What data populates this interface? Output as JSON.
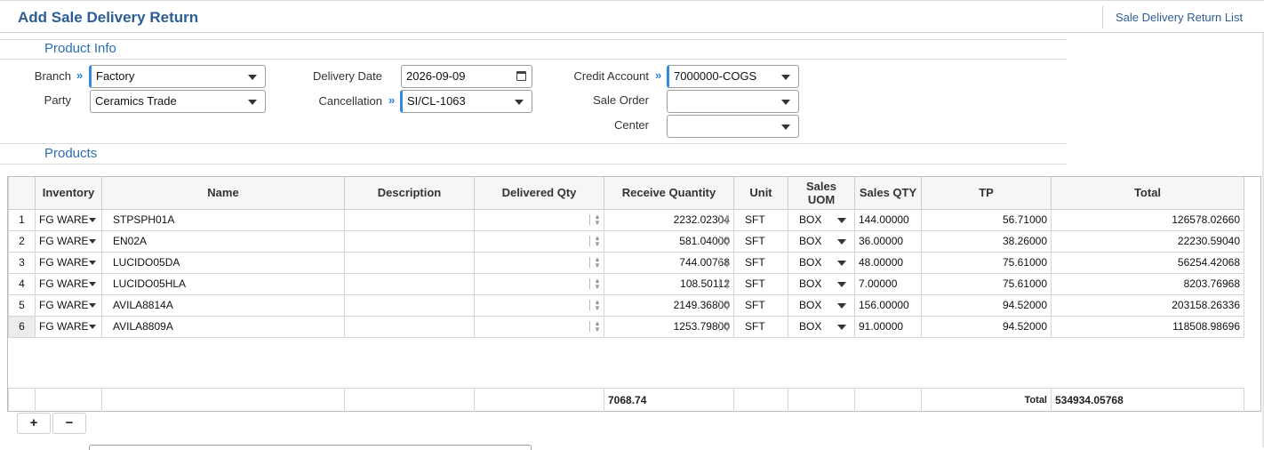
{
  "header": {
    "title": "Add Sale Delivery Return",
    "list_link": "Sale Delivery Return List"
  },
  "product_info": {
    "section_title": "Product Info",
    "branch": {
      "label": "Branch",
      "value": "Factory"
    },
    "party": {
      "label": "Party",
      "value": "Ceramics Trade"
    },
    "delivery_date": {
      "label": "Delivery Date",
      "value": "2026-09-09"
    },
    "cancellation": {
      "label": "Cancellation",
      "value": "SI/CL-1063"
    },
    "credit_account": {
      "label": "Credit Account",
      "value": "7000000-COGS"
    },
    "sale_order": {
      "label": "Sale Order",
      "value": ""
    },
    "center": {
      "label": "Center",
      "value": ""
    }
  },
  "products": {
    "section_title": "Products",
    "columns": [
      "Inventory",
      "Name",
      "Description",
      "Delivered Qty",
      "Receive Quantity",
      "Unit",
      "Sales UOM",
      "Sales QTY",
      "TP",
      "Total"
    ],
    "rows": [
      {
        "no": "1",
        "inventory": "FG WARE",
        "name": "STPSPH01A",
        "description": "",
        "delivered_qty": "",
        "receive_qty": "2232.02304",
        "unit": "SFT",
        "sales_uom": "BOX",
        "sales_qty": "144.00000",
        "tp": "56.71000",
        "total": "126578.02660"
      },
      {
        "no": "2",
        "inventory": "FG WARE",
        "name": "EN02A",
        "description": "",
        "delivered_qty": "",
        "receive_qty": "581.04000",
        "unit": "SFT",
        "sales_uom": "BOX",
        "sales_qty": "36.00000",
        "tp": "38.26000",
        "total": "22230.59040"
      },
      {
        "no": "3",
        "inventory": "FG WARE",
        "name": "LUCIDO05DA",
        "description": "",
        "delivered_qty": "",
        "receive_qty": "744.00768",
        "unit": "SFT",
        "sales_uom": "BOX",
        "sales_qty": "48.00000",
        "tp": "75.61000",
        "total": "56254.42068"
      },
      {
        "no": "4",
        "inventory": "FG WARE",
        "name": "LUCIDO05HLA",
        "description": "",
        "delivered_qty": "",
        "receive_qty": "108.50112",
        "unit": "SFT",
        "sales_uom": "BOX",
        "sales_qty": "7.00000",
        "tp": "75.61000",
        "total": "8203.76968"
      },
      {
        "no": "5",
        "inventory": "FG WARE",
        "name": "AVILA8814A",
        "description": "",
        "delivered_qty": "",
        "receive_qty": "2149.36800",
        "unit": "SFT",
        "sales_uom": "BOX",
        "sales_qty": "156.00000",
        "tp": "94.52000",
        "total": "203158.26336"
      },
      {
        "no": "6",
        "inventory": "FG WARE",
        "name": "AVILA8809A",
        "description": "",
        "delivered_qty": "",
        "receive_qty": "1253.79800",
        "unit": "SFT",
        "sales_uom": "BOX",
        "sales_qty": "91.00000",
        "tp": "94.52000",
        "total": "118508.98696"
      }
    ],
    "totals": {
      "receive_qty": "7068.74",
      "label": "Total",
      "total": "534934.05768"
    }
  },
  "buttons": {
    "add": "+",
    "remove": "−"
  }
}
